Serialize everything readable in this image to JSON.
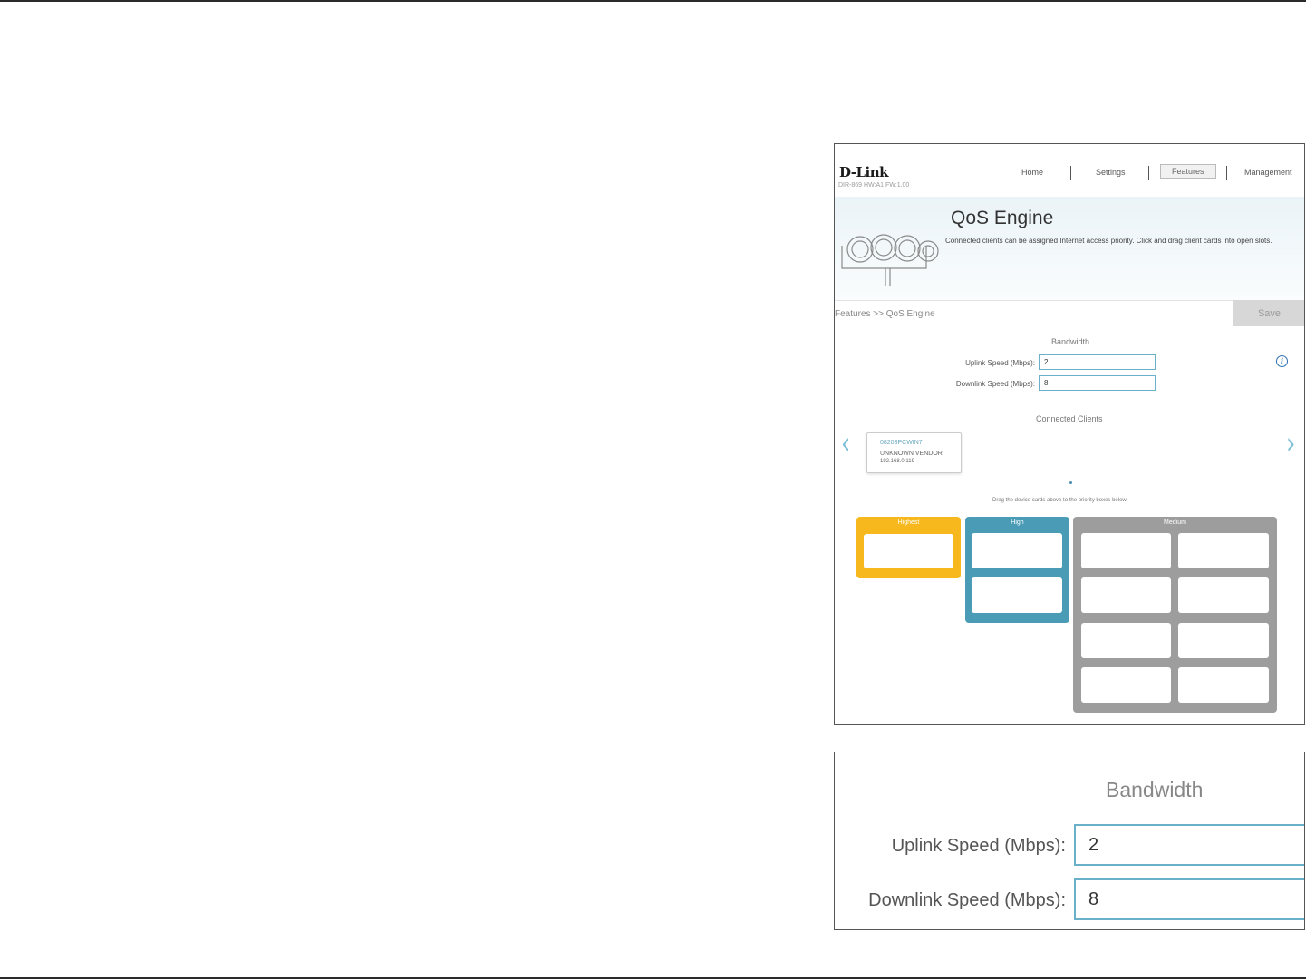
{
  "header": {
    "logo": "D-Link",
    "model": "DIR-869 HW:A1 FW:1.00"
  },
  "nav": {
    "items": [
      "Home",
      "Settings",
      "Features",
      "Management"
    ],
    "active": "Features"
  },
  "page": {
    "title": "QoS Engine",
    "description": "Connected clients can be assigned Internet access priority. Click and drag client cards into open slots.",
    "breadcrumb": "Features >> QoS Engine",
    "save_label": "Save"
  },
  "bandwidth": {
    "title": "Bandwidth",
    "uplink_label": "Uplink Speed (Mbps):",
    "uplink_value": "2",
    "downlink_label": "Downlink Speed (Mbps):",
    "downlink_value": "8"
  },
  "clients": {
    "title": "Connected Clients",
    "cards": [
      {
        "name": "08203PCWIN7",
        "vendor": "UNKNOWN VENDOR",
        "ip": "192.168.0.119"
      }
    ],
    "drag_hint": "Drag the device cards above to the priority boxes below."
  },
  "priority": {
    "highest_label": "Highest",
    "high_label": "High",
    "medium_label": "Medium"
  },
  "colors": {
    "highest": "#f6b81d",
    "high": "#4a9cb6",
    "medium": "#9d9d9d",
    "accent": "#6ab0c8"
  }
}
